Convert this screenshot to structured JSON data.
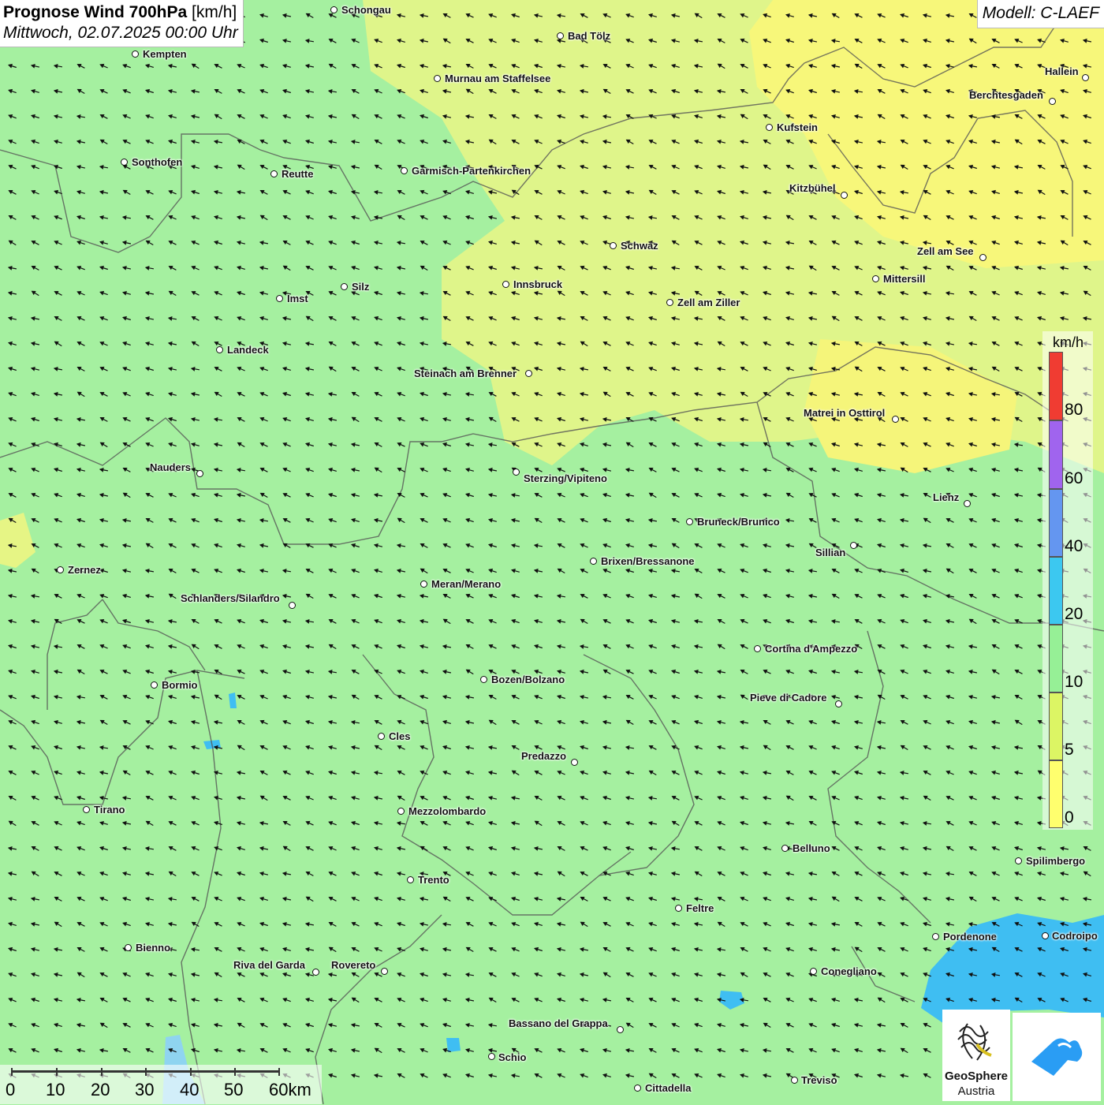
{
  "header": {
    "title_bold": "Prognose Wind 700hPa",
    "title_unit": " [km/h]",
    "datetime": "Mittwoch, 02.07.2025 00:00 Uhr",
    "model": "Modell: C-LAEF"
  },
  "colors": {
    "background_wind_10_20": "#a5f0a0",
    "wind_5_10": "#dff58a",
    "wind_0_5": "#f7f77a",
    "water": "#3fbef2",
    "borders": "#555555",
    "arrows": "#111111"
  },
  "cities": [
    {
      "name": "Schongau"
    },
    {
      "name": "Bad Tölz"
    },
    {
      "name": "Kempten"
    },
    {
      "name": "Murnau am Staffelsee"
    },
    {
      "name": "Hallein"
    },
    {
      "name": "Berchtesgaden"
    },
    {
      "name": "Kufstein"
    },
    {
      "name": "Sonthofen"
    },
    {
      "name": "Reutte"
    },
    {
      "name": "Garmisch-Partenkirchen"
    },
    {
      "name": "Kitzbühel"
    },
    {
      "name": "Schwaz"
    },
    {
      "name": "Zell am See"
    },
    {
      "name": "Mittersill"
    },
    {
      "name": "Silz"
    },
    {
      "name": "Innsbruck"
    },
    {
      "name": "Imst"
    },
    {
      "name": "Zell am Ziller"
    },
    {
      "name": "Landeck"
    },
    {
      "name": "Steinach am Brenner"
    },
    {
      "name": "Matrei in Osttirol"
    },
    {
      "name": "Nauders"
    },
    {
      "name": "Sterzing/Vipiteno"
    },
    {
      "name": "Lienz"
    },
    {
      "name": "Bruneck/Brunico"
    },
    {
      "name": "Sillian"
    },
    {
      "name": "Zernez"
    },
    {
      "name": "Brixen/Bressanone"
    },
    {
      "name": "Meran/Merano"
    },
    {
      "name": "Schlanders/Silandro"
    },
    {
      "name": "Cortina d'Ampezzo"
    },
    {
      "name": "Bozen/Bolzano"
    },
    {
      "name": "Bormio"
    },
    {
      "name": "Pieve di Cadore"
    },
    {
      "name": "Cles"
    },
    {
      "name": "Predazzo"
    },
    {
      "name": "Tirano"
    },
    {
      "name": "Mezzolombardo"
    },
    {
      "name": "Belluno"
    },
    {
      "name": "Spilimbergo"
    },
    {
      "name": "Trento"
    },
    {
      "name": "Feltre"
    },
    {
      "name": "Pordenone"
    },
    {
      "name": "Codroipo"
    },
    {
      "name": "Bienno"
    },
    {
      "name": "Riva del Garda"
    },
    {
      "name": "Rovereto"
    },
    {
      "name": "Conegliano"
    },
    {
      "name": "Bassano del Grappa"
    },
    {
      "name": "Schio"
    },
    {
      "name": "Treviso"
    },
    {
      "name": "Cittadella"
    }
  ],
  "legend": {
    "unit": "km/h",
    "entries": [
      {
        "label": "80",
        "color": "#f03c32"
      },
      {
        "label": "60",
        "color": "#a064ee"
      },
      {
        "label": "40",
        "color": "#6496f0"
      },
      {
        "label": "20",
        "color": "#3cc8f0"
      },
      {
        "label": "10",
        "color": "#96f096"
      },
      {
        "label": "5",
        "color": "#dcf564"
      },
      {
        "label": "0",
        "color": "#ffff6e"
      }
    ]
  },
  "scale": {
    "labels": [
      "0",
      "10",
      "20",
      "30",
      "40",
      "50",
      "60km"
    ]
  },
  "logos": {
    "geosphere_name": "GeoSphere",
    "geosphere_sub": "Austria"
  },
  "wind": {
    "prevailing_direction": "from east-southeast",
    "north_part": "0-10 km/h",
    "south_part": "10-20 km/h"
  }
}
